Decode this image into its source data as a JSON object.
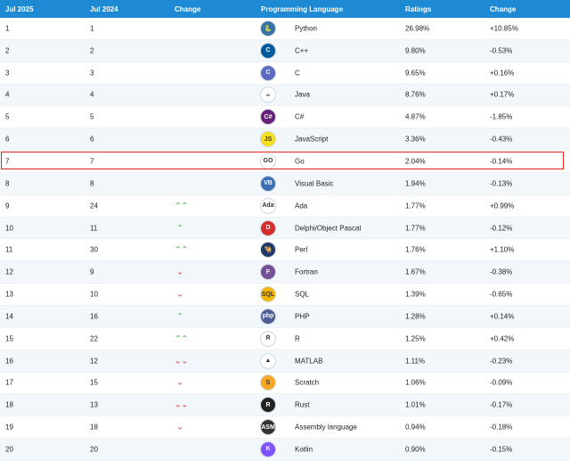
{
  "header": {
    "col_rank_now": "Jul 2025",
    "col_rank_prev": "Jul 2024",
    "col_change": "Change",
    "col_language": "Programming Language",
    "col_ratings": "Ratings",
    "col_delta": "Change"
  },
  "rows": [
    {
      "rank": "1",
      "prev": "1",
      "trend": "",
      "lang": "Python",
      "rating": "26.98%",
      "delta": "+10.85%",
      "icon": "python-icon",
      "icon_glyph": "🐍",
      "icon_color": "#3572A5"
    },
    {
      "rank": "2",
      "prev": "2",
      "trend": "",
      "lang": "C++",
      "rating": "9.80%",
      "delta": "-0.53%",
      "icon": "cpp-icon",
      "icon_glyph": "C",
      "icon_color": "#00599C"
    },
    {
      "rank": "3",
      "prev": "3",
      "trend": "",
      "lang": "C",
      "rating": "9.65%",
      "delta": "+0.16%",
      "icon": "c-icon",
      "icon_glyph": "C",
      "icon_color": "#5C6BC0"
    },
    {
      "rank": "4",
      "prev": "4",
      "trend": "",
      "lang": "Java",
      "rating": "8.76%",
      "delta": "+0.17%",
      "icon": "java-icon",
      "icon_glyph": "☕",
      "icon_color": "#ffffff"
    },
    {
      "rank": "5",
      "prev": "5",
      "trend": "",
      "lang": "C#",
      "rating": "4.87%",
      "delta": "-1.85%",
      "icon": "csharp-icon",
      "icon_glyph": "C#",
      "icon_color": "#68217A"
    },
    {
      "rank": "6",
      "prev": "6",
      "trend": "",
      "lang": "JavaScript",
      "rating": "3.36%",
      "delta": "-0.43%",
      "icon": "javascript-icon",
      "icon_glyph": "JS",
      "icon_color": "#F7DF1E"
    },
    {
      "rank": "7",
      "prev": "7",
      "trend": "",
      "lang": "Go",
      "rating": "2.04%",
      "delta": "-0.14%",
      "icon": "go-icon",
      "icon_glyph": "GO",
      "icon_color": "#ffffff"
    },
    {
      "rank": "8",
      "prev": "8",
      "trend": "",
      "lang": "Visual Basic",
      "rating": "1.94%",
      "delta": "-0.13%",
      "icon": "visual-basic-icon",
      "icon_glyph": "VB",
      "icon_color": "#3d6fb6"
    },
    {
      "rank": "9",
      "prev": "24",
      "trend": "up2",
      "lang": "Ada",
      "rating": "1.77%",
      "delta": "+0.99%",
      "icon": "ada-icon",
      "icon_glyph": "Ada",
      "icon_color": "#ffffff"
    },
    {
      "rank": "10",
      "prev": "11",
      "trend": "up",
      "lang": "Delphi/Object Pascal",
      "rating": "1.77%",
      "delta": "-0.12%",
      "icon": "delphi-icon",
      "icon_glyph": "D",
      "icon_color": "#D32F2F"
    },
    {
      "rank": "11",
      "prev": "30",
      "trend": "up2",
      "lang": "Perl",
      "rating": "1.76%",
      "delta": "+1.10%",
      "icon": "perl-icon",
      "icon_glyph": "🐪",
      "icon_color": "#1f3a68"
    },
    {
      "rank": "12",
      "prev": "9",
      "trend": "down",
      "lang": "Fortran",
      "rating": "1.67%",
      "delta": "-0.38%",
      "icon": "fortran-icon",
      "icon_glyph": "F",
      "icon_color": "#734F96"
    },
    {
      "rank": "13",
      "prev": "10",
      "trend": "down",
      "lang": "SQL",
      "rating": "1.39%",
      "delta": "-0.65%",
      "icon": "sql-icon",
      "icon_glyph": "SQL",
      "icon_color": "#F2B705"
    },
    {
      "rank": "14",
      "prev": "16",
      "trend": "up",
      "lang": "PHP",
      "rating": "1.28%",
      "delta": "+0.14%",
      "icon": "php-icon",
      "icon_glyph": "php",
      "icon_color": "#4F5D95"
    },
    {
      "rank": "15",
      "prev": "22",
      "trend": "up2",
      "lang": "R",
      "rating": "1.25%",
      "delta": "+0.42%",
      "icon": "r-icon",
      "icon_glyph": "R",
      "icon_color": "#ffffff"
    },
    {
      "rank": "16",
      "prev": "12",
      "trend": "down2",
      "lang": "MATLAB",
      "rating": "1.11%",
      "delta": "-0.23%",
      "icon": "matlab-icon",
      "icon_glyph": "▲",
      "icon_color": "#ffffff"
    },
    {
      "rank": "17",
      "prev": "15",
      "trend": "down",
      "lang": "Scratch",
      "rating": "1.06%",
      "delta": "-0.09%",
      "icon": "scratch-icon",
      "icon_glyph": "S",
      "icon_color": "#F9A825"
    },
    {
      "rank": "18",
      "prev": "13",
      "trend": "down2",
      "lang": "Rust",
      "rating": "1.01%",
      "delta": "-0.17%",
      "icon": "rust-icon",
      "icon_glyph": "R",
      "icon_color": "#222222"
    },
    {
      "rank": "19",
      "prev": "18",
      "trend": "down",
      "lang": "Assembly language",
      "rating": "0.94%",
      "delta": "-0.18%",
      "icon": "assembly-icon",
      "icon_glyph": "ASM",
      "icon_color": "#333333"
    },
    {
      "rank": "20",
      "prev": "20",
      "trend": "",
      "lang": "Kotlin",
      "rating": "0.90%",
      "delta": "-0.15%",
      "icon": "kotlin-icon",
      "icon_glyph": "K",
      "icon_color": "#7F52FF"
    }
  ]
}
